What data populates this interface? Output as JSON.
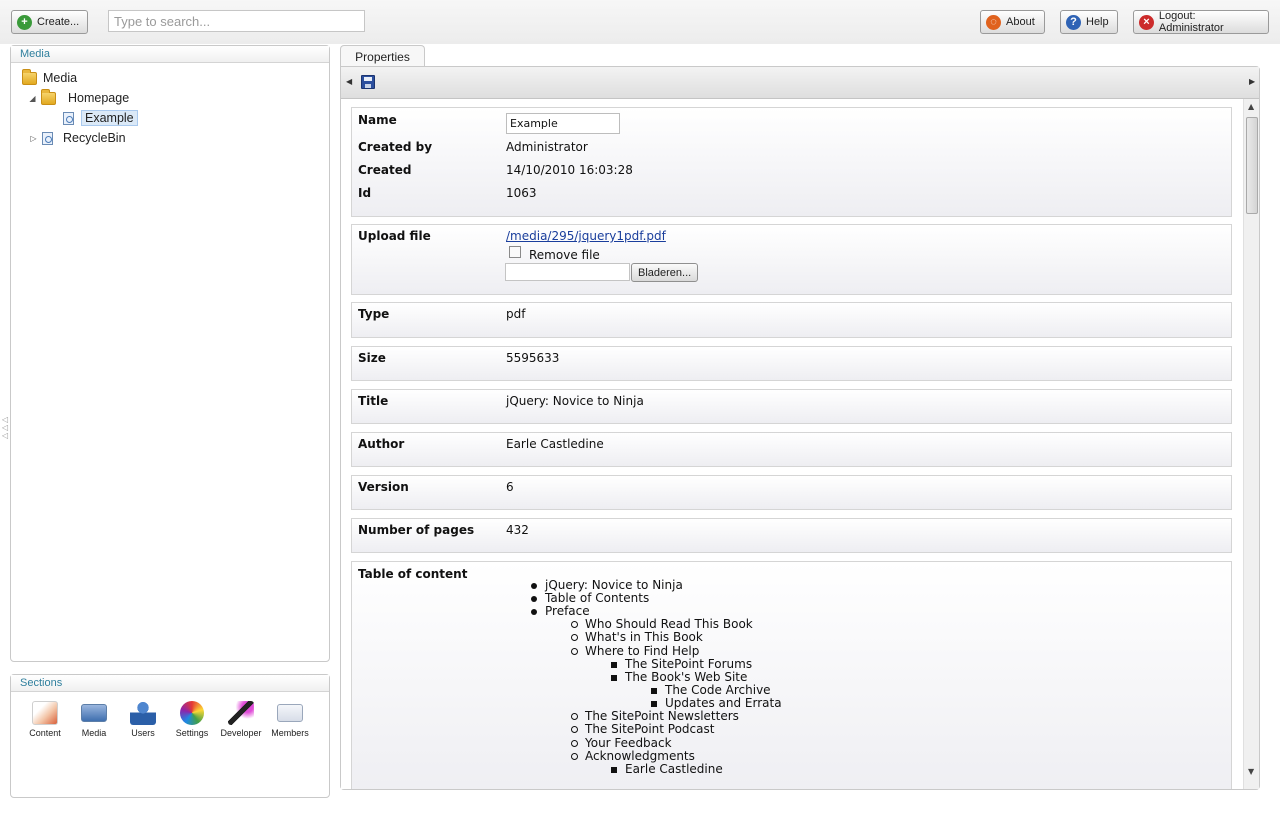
{
  "topbar": {
    "create_label": "Create...",
    "search_placeholder": "Type to search...",
    "about_label": "About",
    "help_label": "Help",
    "logout_label": "Logout: Administrator"
  },
  "media_panel": {
    "title": "Media",
    "tree": [
      {
        "label": "Media",
        "icon": "folder-icon"
      },
      {
        "label": "Homepage",
        "icon": "folder-icon"
      },
      {
        "label": "Example",
        "icon": "document-icon"
      },
      {
        "label": "RecycleBin",
        "icon": "recycle-bin-icon"
      }
    ]
  },
  "sections_panel": {
    "title": "Sections",
    "items": [
      {
        "label": "Content",
        "icon": "content-icon",
        "color": "#d9603b"
      },
      {
        "label": "Media",
        "icon": "media-icon",
        "color": "#3f6fae"
      },
      {
        "label": "Users",
        "icon": "users-icon",
        "color": "#2b5fa8"
      },
      {
        "label": "Settings",
        "icon": "settings-icon",
        "color": "#e8a317"
      },
      {
        "label": "Developer",
        "icon": "developer-icon",
        "color": "#8a2a8e"
      },
      {
        "label": "Members",
        "icon": "members-icon",
        "color": "#6b7f99"
      }
    ]
  },
  "properties": {
    "tab_label": "Properties",
    "name_label": "Name",
    "name_value": "Example",
    "created_by_label": "Created by",
    "created_by_value": "Administrator",
    "created_label": "Created",
    "created_value": "14/10/2010 16:03:28",
    "id_label": "Id",
    "id_value": "1063",
    "upload_label": "Upload file",
    "upload_link": "/media/295/jquery1pdf.pdf",
    "remove_file_label": "Remove file",
    "browse_label": "Bladeren...",
    "type_label": "Type",
    "type_value": "pdf",
    "size_label": "Size",
    "size_value": "5595633",
    "title_label": "Title",
    "title_value": "jQuery: Novice to Ninja",
    "author_label": "Author",
    "author_value": "Earle Castledine",
    "version_label": "Version",
    "version_value": "6",
    "pages_label": "Number of pages",
    "pages_value": "432",
    "toc_label": "Table of content",
    "toc": [
      {
        "text": "jQuery: Novice to Ninja",
        "level": 1
      },
      {
        "text": "Table of Contents",
        "level": 1
      },
      {
        "text": "Preface",
        "level": 1
      },
      {
        "text": "Who Should Read This Book",
        "level": 2
      },
      {
        "text": "What's in This Book",
        "level": 2
      },
      {
        "text": "Where to Find Help",
        "level": 2
      },
      {
        "text": "The SitePoint Forums",
        "level": 3
      },
      {
        "text": "The Book's Web Site",
        "level": 3
      },
      {
        "text": "The Code Archive",
        "level": 4
      },
      {
        "text": "Updates and Errata",
        "level": 4
      },
      {
        "text": "The SitePoint Newsletters",
        "level": 2
      },
      {
        "text": "The SitePoint Podcast",
        "level": 2
      },
      {
        "text": "Your Feedback",
        "level": 2
      },
      {
        "text": "Acknowledgments",
        "level": 2
      },
      {
        "text": "Earle Castledine",
        "level": 3
      }
    ]
  }
}
